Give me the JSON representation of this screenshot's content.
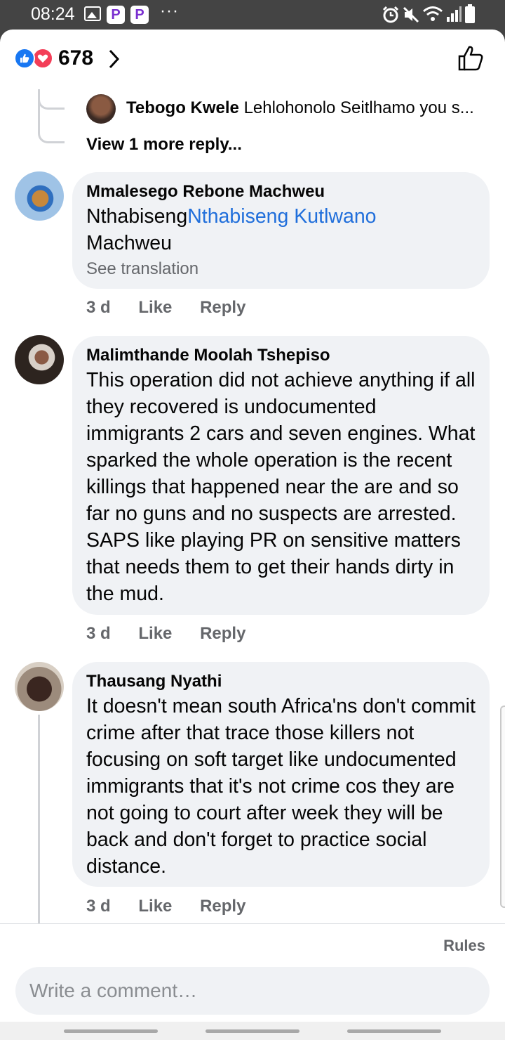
{
  "status_bar": {
    "time": "08:24",
    "p_label": "P",
    "dots": "···",
    "icons": [
      "image-icon",
      "p-app-icon",
      "p-app-icon",
      "more-dots-icon",
      "alarm-icon",
      "mute-icon",
      "wifi-icon",
      "signal-icon",
      "battery-icon"
    ]
  },
  "reactions": {
    "count": "678",
    "icons": [
      "like-reaction-icon",
      "love-reaction-icon",
      "chevron-right-icon",
      "thumbs-up-icon"
    ],
    "colors": {
      "like": "#1877f2",
      "love": "#f33e58"
    }
  },
  "thread": {
    "reply_preview": {
      "author": "Tebogo Kwele",
      "text": "Lehlohonolo Seitlhamo you s..."
    },
    "view_more_label": "View 1 more reply..."
  },
  "comments": [
    {
      "author": "Mmalesego Rebone Machweu",
      "text_pre": "Nthabiseng",
      "mention": "Nthabiseng Kutlwano",
      "text_post": "Machweu",
      "translate_label": "See translation",
      "time": "3 d",
      "like_label": "Like",
      "reply_label": "Reply"
    },
    {
      "author": "Malimthande Moolah Tshepiso",
      "text": "This operation did not achieve anything if all they recovered is undocumented immigrants 2 cars and seven engines. What sparked the whole operation is the recent killings that happened near the are and so far no guns and no suspects are arrested. SAPS like playing PR on sensitive matters that needs them to get their hands dirty in the mud.",
      "time": "3 d",
      "like_label": "Like",
      "reply_label": "Reply"
    },
    {
      "author": "Thausang Nyathi",
      "text": "It doesn't mean south Africa'ns don't commit crime after that trace those killers not focusing on soft target like undocumented immigrants that it's not crime cos they are not going to court after week they will be back and don't forget to practice social distance.",
      "time": "3 d",
      "like_label": "Like",
      "reply_label": "Reply"
    }
  ],
  "composer": {
    "rules_label": "Rules",
    "placeholder": "Write a comment…"
  },
  "colors": {
    "mention": "#216fdb",
    "bubble": "#f0f2f5",
    "secondary_text": "#65676b"
  }
}
